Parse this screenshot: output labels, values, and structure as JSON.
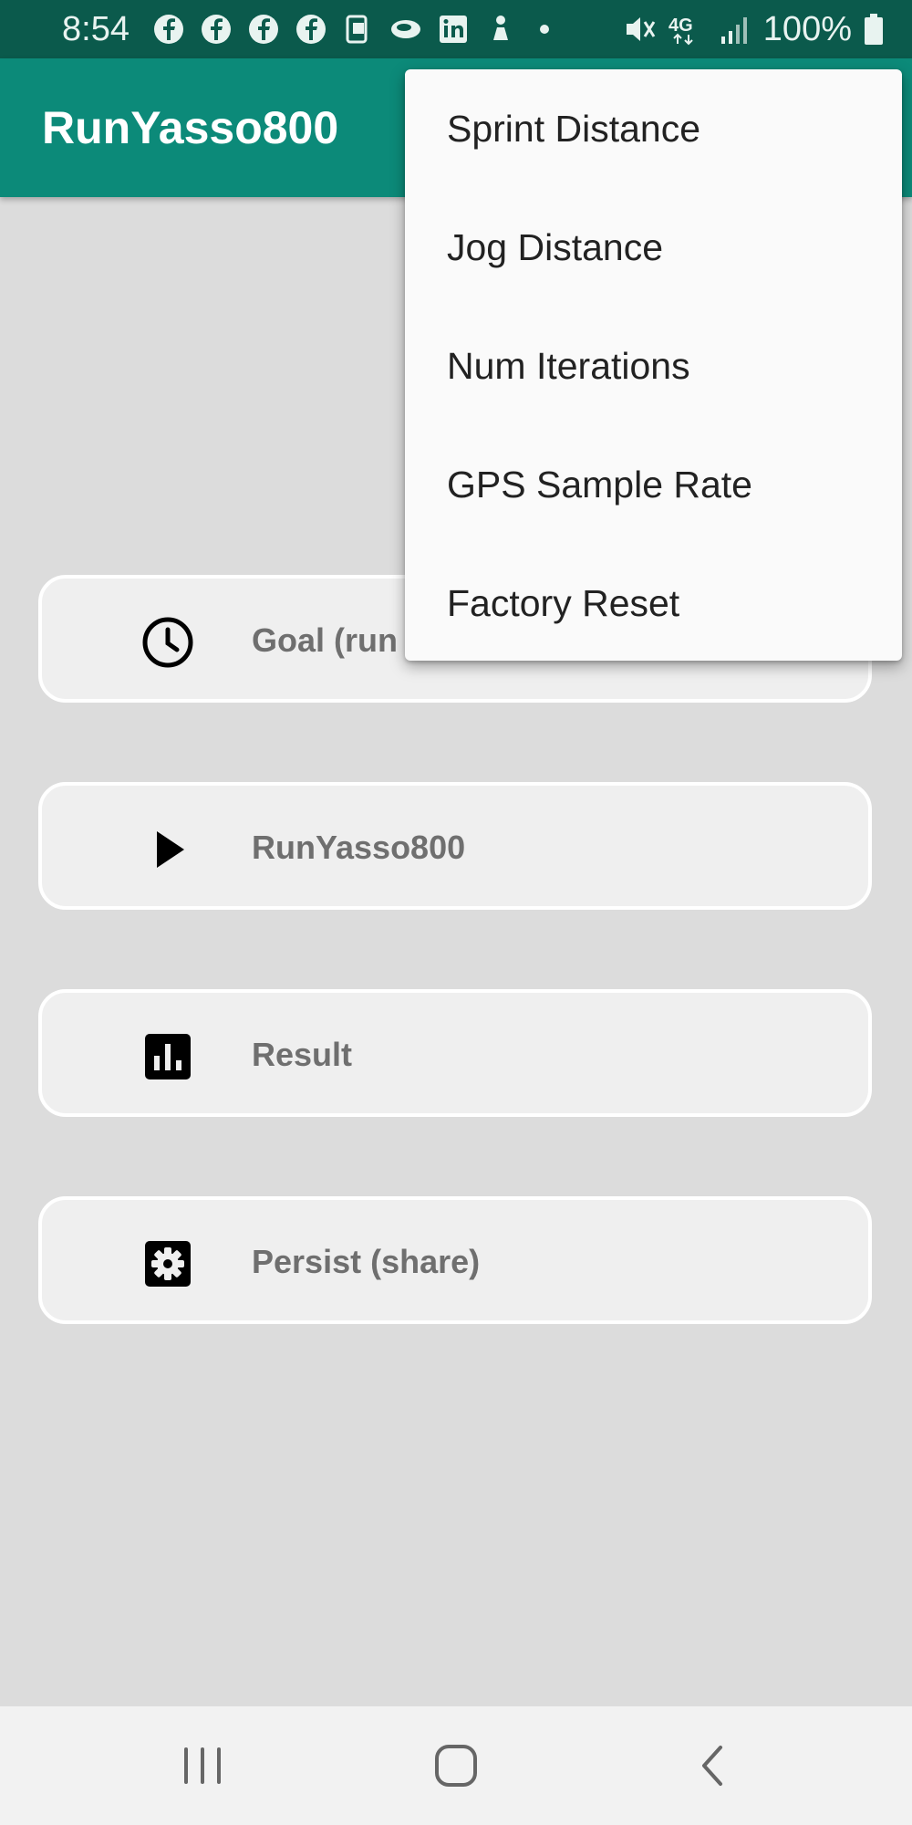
{
  "status_bar": {
    "time": "8:54",
    "battery": "100%",
    "network": "4G"
  },
  "app_bar": {
    "title": "RunYasso800"
  },
  "cards": [
    {
      "label": "Goal (run",
      "icon": "clock-icon"
    },
    {
      "label": "RunYasso800",
      "icon": "play-icon"
    },
    {
      "label": "Result",
      "icon": "bar-chart-icon"
    },
    {
      "label": "Persist (share)",
      "icon": "settings-icon"
    }
  ],
  "menu": {
    "items": [
      {
        "label": "Sprint Distance"
      },
      {
        "label": "Jog Distance"
      },
      {
        "label": "Num Iterations"
      },
      {
        "label": "GPS Sample Rate"
      },
      {
        "label": "Factory Reset"
      }
    ]
  },
  "colors": {
    "status_bar": "#0b5a4c",
    "app_bar": "#0c8a79",
    "background": "#dcdcdc",
    "card": "#efefef"
  }
}
